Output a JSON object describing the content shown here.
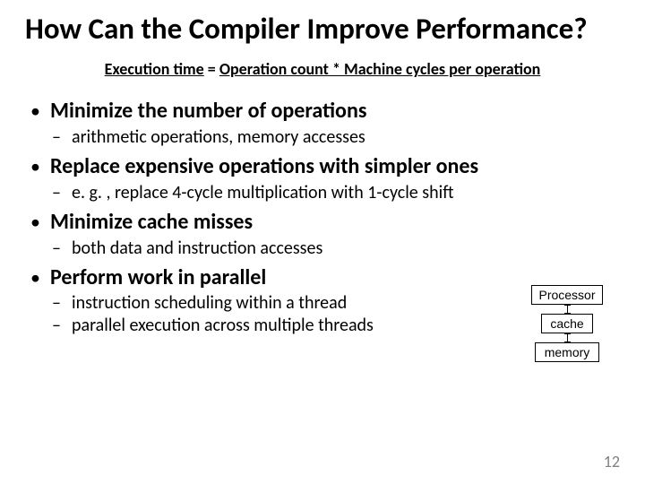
{
  "title": "How Can the Compiler Improve Performance?",
  "equation": {
    "lhs": "Execution time",
    "eq": " = ",
    "rhs": "Operation count * Machine cycles per operation"
  },
  "bullets": [
    {
      "text": "Minimize the number of operations",
      "sub": [
        "arithmetic operations, memory accesses"
      ]
    },
    {
      "text": "Replace expensive operations with simpler ones",
      "sub": [
        "e. g. , replace 4-cycle multiplication with 1-cycle shift"
      ]
    },
    {
      "text": "Minimize cache misses",
      "sub": [
        "both data and instruction accesses"
      ]
    },
    {
      "text": "Perform work in parallel",
      "sub": [
        "instruction scheduling within a thread",
        "parallel execution across multiple threads"
      ]
    }
  ],
  "diagram": {
    "box0": "Processor",
    "box1": "cache",
    "box2": "memory"
  },
  "page_number": "12"
}
